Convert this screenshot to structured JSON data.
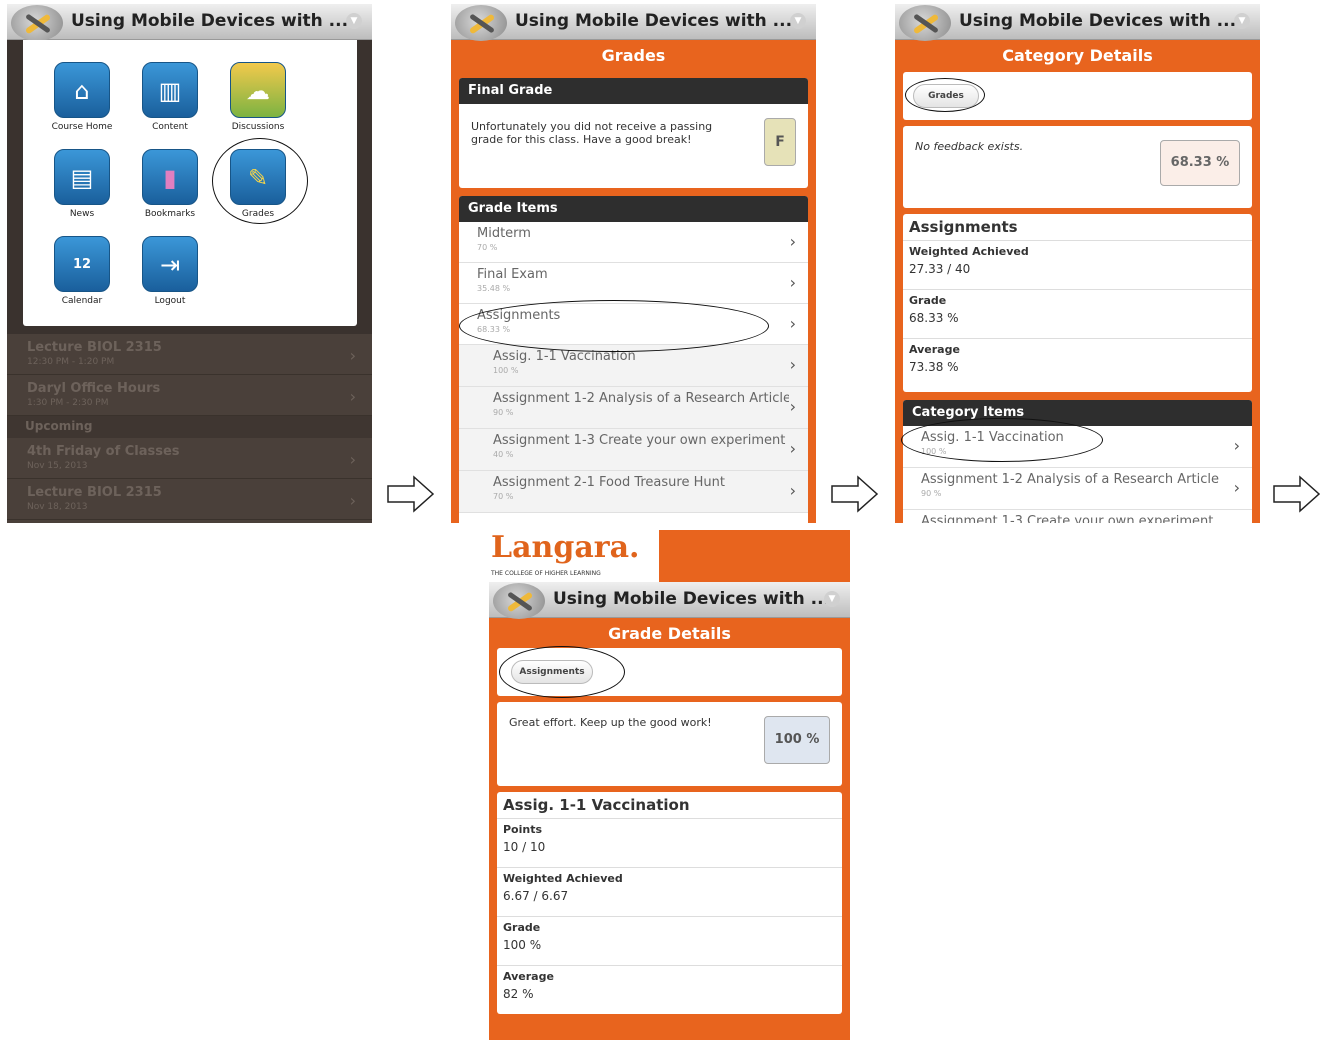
{
  "course_title": "Using Mobile Devices with ...",
  "screen1": {
    "tiles": [
      {
        "label": "Course Home",
        "icon": "house-icon",
        "glyph": "⌂"
      },
      {
        "label": "Content",
        "icon": "book-icon",
        "glyph": "▥"
      },
      {
        "label": "Discussions",
        "icon": "speech-bubble-icon",
        "glyph": "☁"
      },
      {
        "label": "News",
        "icon": "newspaper-icon",
        "glyph": "▤"
      },
      {
        "label": "Bookmarks",
        "icon": "bookmark-icon",
        "glyph": "▮"
      },
      {
        "label": "Grades",
        "icon": "ruler-icon",
        "glyph": "✎"
      },
      {
        "label": "Calendar",
        "icon": "calendar-icon",
        "glyph": "12"
      },
      {
        "label": "Logout",
        "icon": "door-exit-icon",
        "glyph": "⇥"
      }
    ],
    "events": [
      {
        "title": "Lecture BIOL 2315",
        "sub": "12:30 PM - 1:20 PM"
      },
      {
        "title": "Daryl Office Hours",
        "sub": "1:30 PM - 2:30 PM"
      }
    ],
    "upcoming_label": "Upcoming",
    "upcoming": [
      {
        "title": "4th Friday of Classes",
        "sub": "Nov 15, 2013"
      },
      {
        "title": "Lecture BIOL 2315",
        "sub": "Nov 18, 2013"
      }
    ]
  },
  "screen2": {
    "page_title": "Grades",
    "final_grade_header": "Final Grade",
    "final_grade_message": "Unfortunately you did not receive a passing grade for this class. Have a good break!",
    "final_grade_value": "F",
    "grade_items_header": "Grade Items",
    "items": [
      {
        "title": "Midterm",
        "sub": "70 %",
        "sub_item": false
      },
      {
        "title": "Final Exam",
        "sub": "35.48 %",
        "sub_item": false
      },
      {
        "title": "Assignments",
        "sub": "68.33 %",
        "sub_item": false
      },
      {
        "title": "Assig. 1-1 Vaccination",
        "sub": "100 %",
        "sub_item": true
      },
      {
        "title": "Assignment 1-2 Analysis of a Research Article",
        "sub": "90 %",
        "sub_item": true
      },
      {
        "title": "Assignment 1-3 Create your own experiment",
        "sub": "40 %",
        "sub_item": true
      },
      {
        "title": "Assignment 2-1 Food Treasure Hunt",
        "sub": "70 %",
        "sub_item": true
      }
    ]
  },
  "screen3": {
    "page_title": "Category Details",
    "back_button": "Grades",
    "feedback": "No feedback exists.",
    "score": "68.33 %",
    "section_title": "Assignments",
    "fields": [
      {
        "label": "Weighted Achieved",
        "value": "27.33 / 40"
      },
      {
        "label": "Grade",
        "value": "68.33 %"
      },
      {
        "label": "Average",
        "value": "73.38 %"
      }
    ],
    "category_items_header": "Category Items",
    "items": [
      {
        "title": "Assig. 1-1 Vaccination",
        "sub": "100 %"
      },
      {
        "title": "Assignment 1-2 Analysis of a Research Article",
        "sub": "90 %"
      },
      {
        "title": "Assignment 1-3 Create your own experiment",
        "sub": ""
      }
    ]
  },
  "screen4": {
    "logo_text": "Langara.",
    "logo_tagline": "THE COLLEGE OF HIGHER LEARNING",
    "page_title": "Grade Details",
    "back_button": "Assignments",
    "feedback": "Great effort. Keep up the good work!",
    "score": "100 %",
    "section_title": "Assig. 1-1 Vaccination",
    "fields": [
      {
        "label": "Points",
        "value": "10 / 10"
      },
      {
        "label": "Weighted Achieved",
        "value": "6.67 / 6.67"
      },
      {
        "label": "Grade",
        "value": "100 %"
      },
      {
        "label": "Average",
        "value": "82 %"
      }
    ]
  },
  "colors": {
    "accent": "#e8641e",
    "dark_header": "#2e2e2e",
    "logo": "#e0641c"
  }
}
